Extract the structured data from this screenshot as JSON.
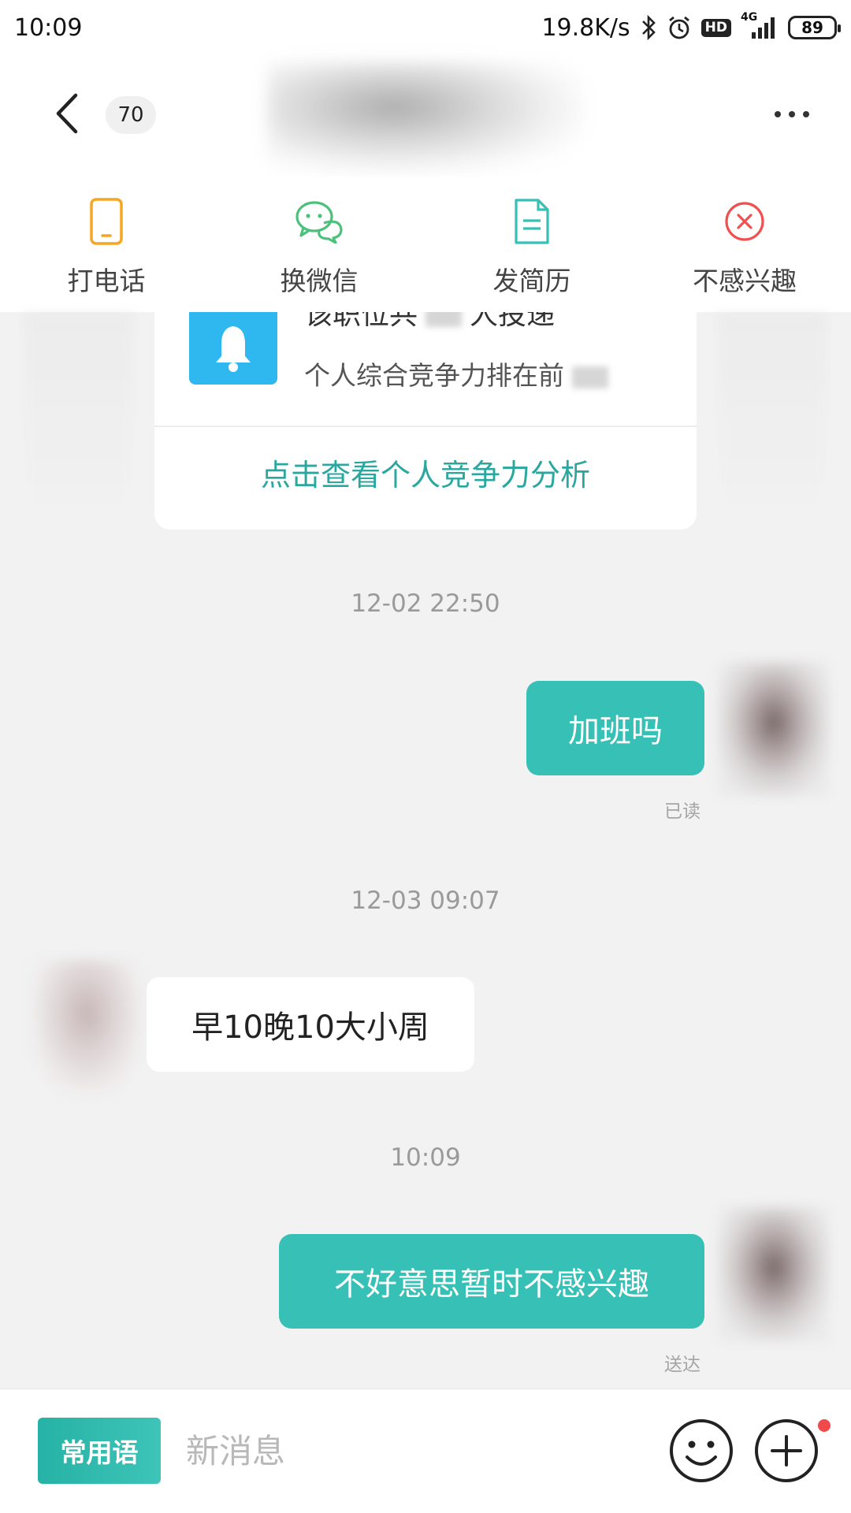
{
  "status_bar": {
    "time": "10:09",
    "net_speed": "19.8K/s",
    "hd_label": "HD",
    "network_label": "4G",
    "battery": "89"
  },
  "header": {
    "unread_count": "70"
  },
  "actions": [
    {
      "label": "打电话",
      "icon": "phone-icon",
      "color": "#f5a623"
    },
    {
      "label": "换微信",
      "icon": "wechat-icon",
      "color": "#4cc17c"
    },
    {
      "label": "发简历",
      "icon": "resume-icon",
      "color": "#37c0b6"
    },
    {
      "label": "不感兴趣",
      "icon": "not-interested-icon",
      "color": "#f05050"
    }
  ],
  "job_card": {
    "line1_prefix": "该职位共",
    "line1_suffix": "人投递",
    "line2_prefix": "个人综合竞争力排在前",
    "link_text": "点击查看个人竞争力分析"
  },
  "messages": [
    {
      "type": "timestamp",
      "text": "12-02 22:50"
    },
    {
      "type": "me",
      "text": "加班吗",
      "status": "已读"
    },
    {
      "type": "timestamp",
      "text": "12-03 09:07"
    },
    {
      "type": "other",
      "text": "早10晚10大小周"
    },
    {
      "type": "timestamp",
      "text": "10:09"
    },
    {
      "type": "me",
      "text": "不好意思暂时不感兴趣",
      "status": "送达"
    }
  ],
  "input_bar": {
    "phrase_button": "常用语",
    "placeholder": "新消息"
  },
  "colors": {
    "accent": "#37c0b6",
    "link": "#2aa79f",
    "bell": "#2fb7f0"
  }
}
